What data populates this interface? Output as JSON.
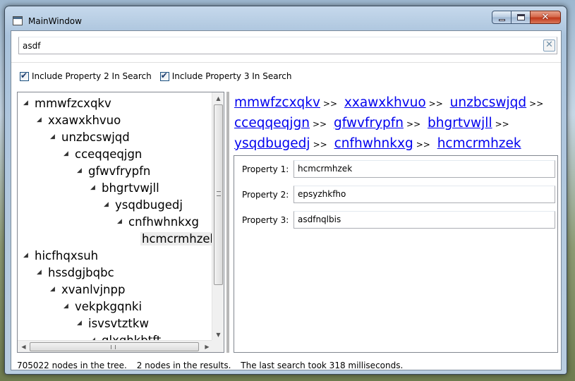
{
  "window": {
    "title": "MainWindow"
  },
  "search": {
    "value": "asdf",
    "clear_glyph": "✕"
  },
  "options": [
    {
      "label": "Include Property 2 In Search",
      "checked": true
    },
    {
      "label": "Include Property 3 In Search",
      "checked": true
    }
  ],
  "tree": {
    "items": [
      {
        "label": "mmwfzcxqkv",
        "level": 0,
        "expanded": true
      },
      {
        "label": "xxawxkhvuo",
        "level": 1,
        "expanded": true
      },
      {
        "label": "unzbcswjqd",
        "level": 2,
        "expanded": true
      },
      {
        "label": "cceqqeqjgn",
        "level": 3,
        "expanded": true
      },
      {
        "label": "gfwvfrypfn",
        "level": 4,
        "expanded": true
      },
      {
        "label": "bhgrtvwjll",
        "level": 5,
        "expanded": true
      },
      {
        "label": "ysqdbugedj",
        "level": 6,
        "expanded": true
      },
      {
        "label": "cnfhwhnkxg",
        "level": 7,
        "expanded": true
      },
      {
        "label": "hcmcrmhzek",
        "level": 8,
        "expanded": false,
        "selected": true
      },
      {
        "label": "hicfhqxsuh",
        "level": 0,
        "expanded": true
      },
      {
        "label": "hssdgjbqbc",
        "level": 1,
        "expanded": true
      },
      {
        "label": "xvanlvjnpp",
        "level": 2,
        "expanded": true
      },
      {
        "label": "vekpkgqnki",
        "level": 3,
        "expanded": true
      },
      {
        "label": "isvsvtztkw",
        "level": 4,
        "expanded": true
      },
      {
        "label": "glxqhkbtft",
        "level": 5,
        "expanded": true
      }
    ]
  },
  "breadcrumb": {
    "items": [
      "mmwfzcxqkv",
      "xxawxkhvuo",
      "unzbcswjqd",
      "cceqqeqjgn",
      "gfwvfrypfn",
      "bhgrtvwjll",
      "ysqdbugedj",
      "cnfhwhnkxg",
      "hcmcrmhzek"
    ],
    "separator": ">>"
  },
  "properties": [
    {
      "label": "Property 1:",
      "value": "hcmcrmhzek"
    },
    {
      "label": "Property 2:",
      "value": "epsyzhkfho"
    },
    {
      "label": "Property 3:",
      "value": "asdfnqlbis"
    }
  ],
  "status": {
    "nodes": "705022 nodes in the tree.",
    "results": "2 nodes in the results.",
    "timing": "The last search took 318 milliseconds."
  }
}
